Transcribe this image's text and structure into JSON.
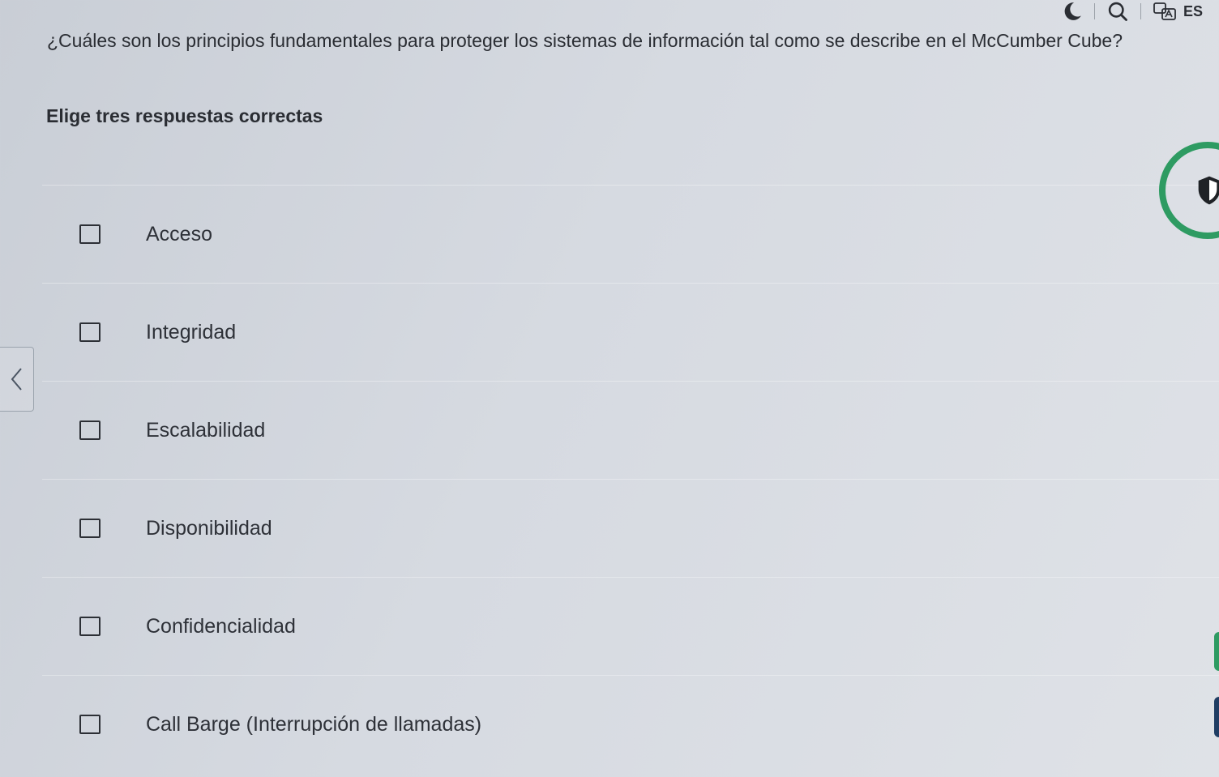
{
  "header": {
    "language_code": "ES",
    "icons": [
      "dark-mode-icon",
      "search-icon",
      "translate-icon"
    ]
  },
  "quiz": {
    "question": "¿Cuáles son los principios fundamentales para proteger los sistemas de información tal como se describe en el McCumber Cube?",
    "instruction": "Elige tres respuestas correctas",
    "options": [
      {
        "label": "Acceso",
        "checked": false
      },
      {
        "label": "Integridad",
        "checked": false
      },
      {
        "label": "Escalabilidad",
        "checked": false
      },
      {
        "label": "Disponibilidad",
        "checked": false
      },
      {
        "label": "Confidencialidad",
        "checked": false
      },
      {
        "label": "Call Barge (Interrupción de llamadas)",
        "checked": false
      }
    ]
  },
  "colors": {
    "accent_green": "#2e9b62",
    "text": "#2a2d33",
    "edge_blue": "#1f3d63"
  }
}
